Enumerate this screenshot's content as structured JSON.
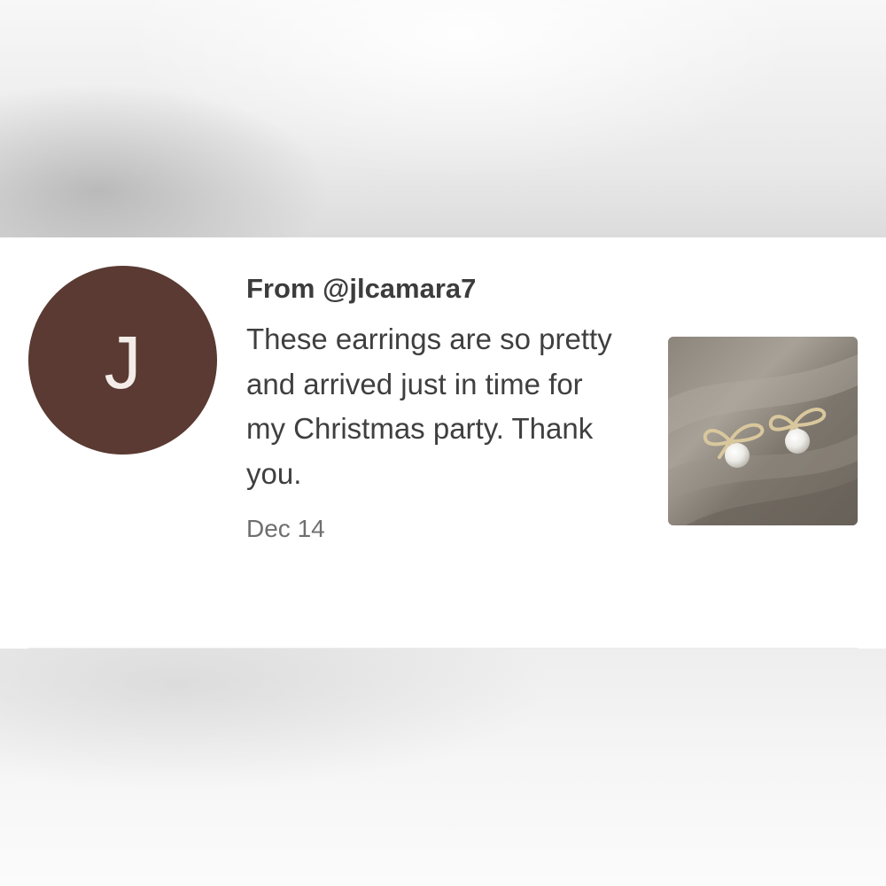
{
  "review": {
    "avatar_letter": "J",
    "avatar_color": "#5a3a32",
    "from_label": "From @jlcamara7",
    "message": "These earrings are so pretty and arrived just in time for my Christmas party. Thank you.",
    "date": "Dec 14",
    "photo_icon": "earrings-photo"
  }
}
